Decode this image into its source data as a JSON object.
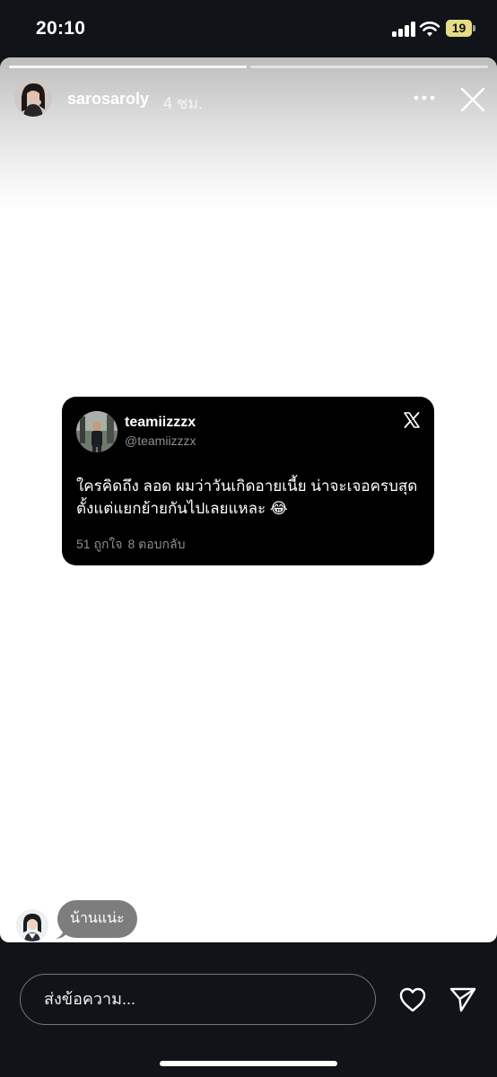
{
  "status_bar": {
    "time": "20:10",
    "battery_level": "19",
    "icons": [
      "signal-icon",
      "wifi-icon",
      "battery-icon"
    ]
  },
  "story": {
    "username": "sarosaroly",
    "time_ago": "4 ชม.",
    "progress_segments": 2,
    "icons": [
      "more-icon",
      "close-icon"
    ]
  },
  "tweet": {
    "display_name": "teamiizzzx",
    "handle": "@teamiizzzx",
    "text": "ใครคิดถึง ลอด ผมว่าวันเกิดอายเนี้ย น่าจะเจอครบสุดตั้งแต่แยกย้ายกันไปเลยแหละ 😂",
    "likes": "51 ถูกใจ",
    "replies": "8 ตอบกลับ",
    "icon": "x-logo-icon"
  },
  "reply": {
    "text": "น้านแน่ะ"
  },
  "message_bar": {
    "placeholder": "ส่งข้อความ...",
    "icons": [
      "heart-icon",
      "send-icon"
    ]
  },
  "colors": {
    "background": "#101418",
    "tweet_card": "#000000",
    "muted_text": "#8b8f93",
    "reply_bubble": "#7d7d7d"
  }
}
